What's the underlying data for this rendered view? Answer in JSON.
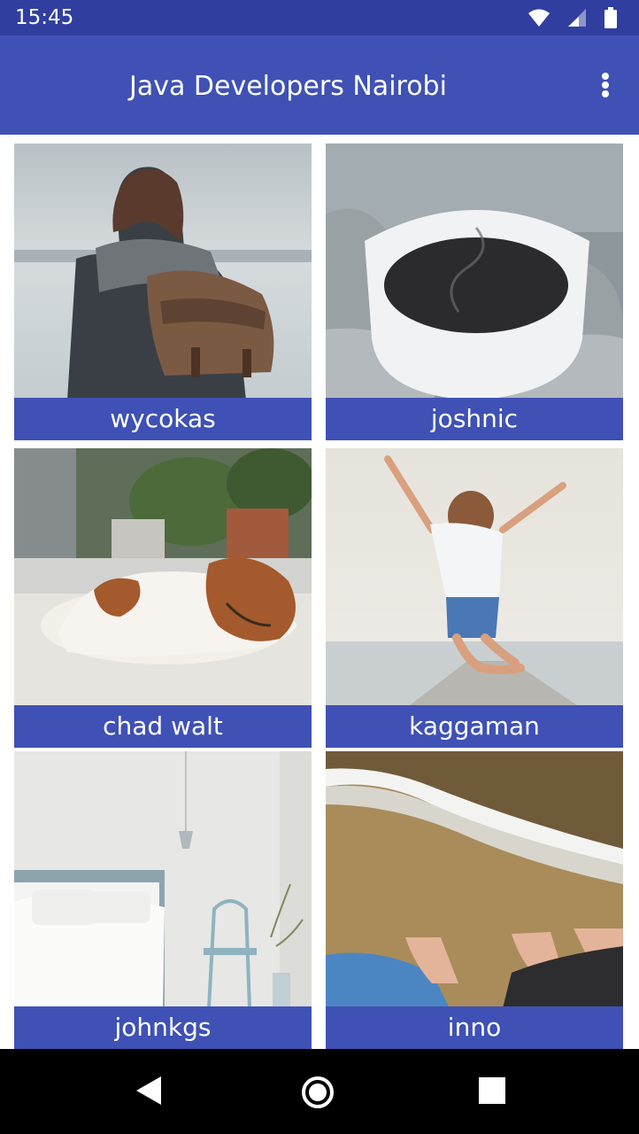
{
  "status_bar": {
    "time": "15:45"
  },
  "app_bar": {
    "title": "Java Developers Nairobi"
  },
  "grid": {
    "items": [
      {
        "name": "wycokas"
      },
      {
        "name": "joshnic"
      },
      {
        "name": "chad walt"
      },
      {
        "name": "kaggaman"
      },
      {
        "name": "johnkgs"
      },
      {
        "name": "inno"
      }
    ]
  },
  "colors": {
    "primary": "#3f51b5",
    "primary_dark": "#303f9f"
  }
}
